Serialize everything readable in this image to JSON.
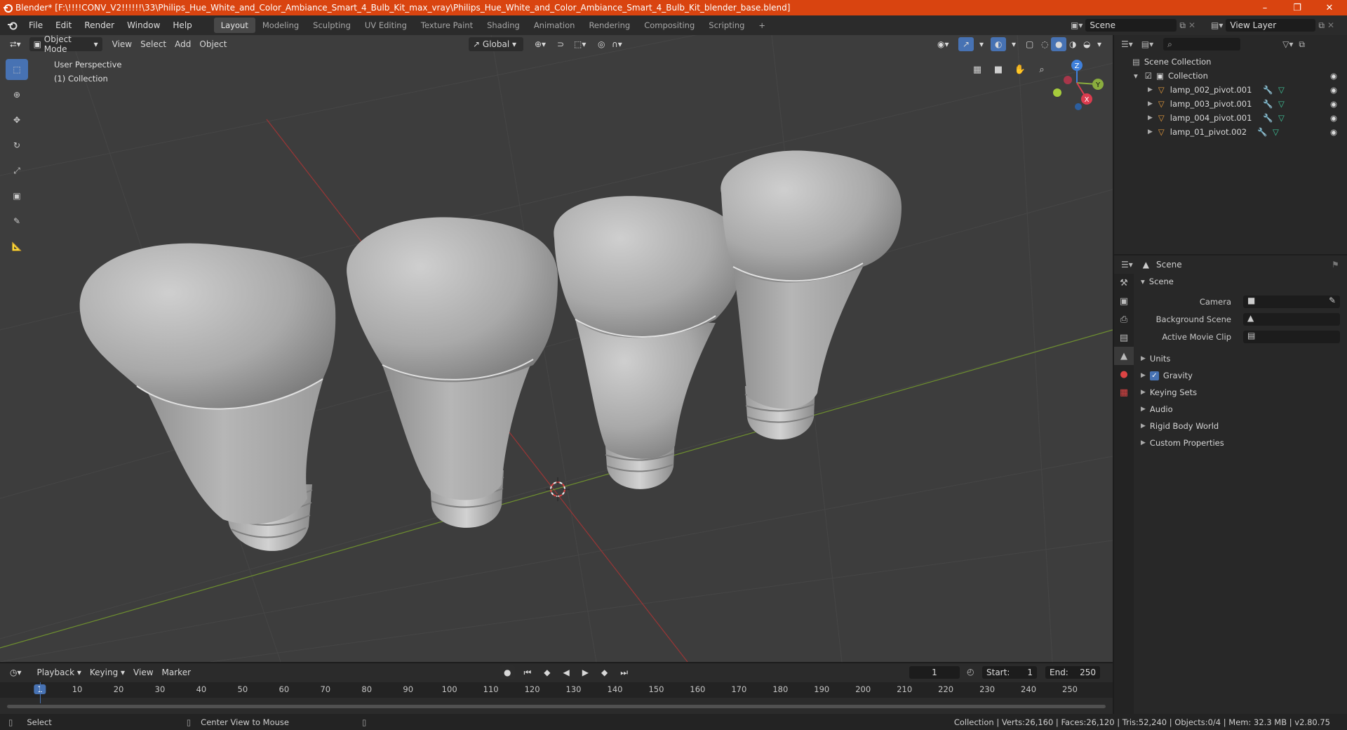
{
  "window": {
    "title": "Blender* [F:\\!!!!CONV_V2!!!!!!\\33\\Philips_Hue_White_and_Color_Ambiance_Smart_4_Bulb_Kit_max_vray\\Philips_Hue_White_and_Color_Ambiance_Smart_4_Bulb_Kit_blender_base.blend]",
    "accent": "#d94410"
  },
  "menus": [
    "File",
    "Edit",
    "Render",
    "Window",
    "Help"
  ],
  "workspaces": [
    "Layout",
    "Modeling",
    "Sculpting",
    "UV Editing",
    "Texture Paint",
    "Shading",
    "Animation",
    "Rendering",
    "Compositing",
    "Scripting"
  ],
  "active_workspace": "Layout",
  "scene_field": "Scene",
  "view_layer_field": "View Layer",
  "viewport": {
    "mode": "Object Mode",
    "menus": [
      "View",
      "Select",
      "Add",
      "Object"
    ],
    "orientation": "Global",
    "overlay_line1": "User Perspective",
    "overlay_line2": "(1) Collection",
    "axes": {
      "x": "X",
      "y": "Y",
      "z": "Z"
    }
  },
  "outliner": {
    "root": "Scene Collection",
    "collection": "Collection",
    "items": [
      "lamp_002_pivot.001",
      "lamp_003_pivot.001",
      "lamp_004_pivot.001",
      "lamp_01_pivot.002"
    ]
  },
  "properties": {
    "header": "Scene",
    "panel": "Scene",
    "fields": [
      "Camera",
      "Background Scene",
      "Active Movie Clip"
    ],
    "sections": [
      "Units",
      "Gravity",
      "Keying Sets",
      "Audio",
      "Rigid Body World",
      "Custom Properties"
    ],
    "gravity_checked": true
  },
  "timeline": {
    "menus": [
      "Playback",
      "Keying",
      "View",
      "Marker"
    ],
    "current_frame": "1",
    "start_label": "Start:",
    "start": "1",
    "end_label": "End:",
    "end": "250",
    "ticks": [
      "1",
      "10",
      "20",
      "30",
      "40",
      "50",
      "60",
      "70",
      "80",
      "90",
      "100",
      "110",
      "120",
      "130",
      "140",
      "150",
      "160",
      "170",
      "180",
      "190",
      "200",
      "210",
      "220",
      "230",
      "240",
      "250"
    ]
  },
  "status": {
    "left": "Select",
    "middle": "Center View to Mouse",
    "right": "Collection | Verts:26,160 | Faces:26,120 | Tris:52,240 | Objects:0/4 | Mem: 32.3 MB | v2.80.75"
  }
}
